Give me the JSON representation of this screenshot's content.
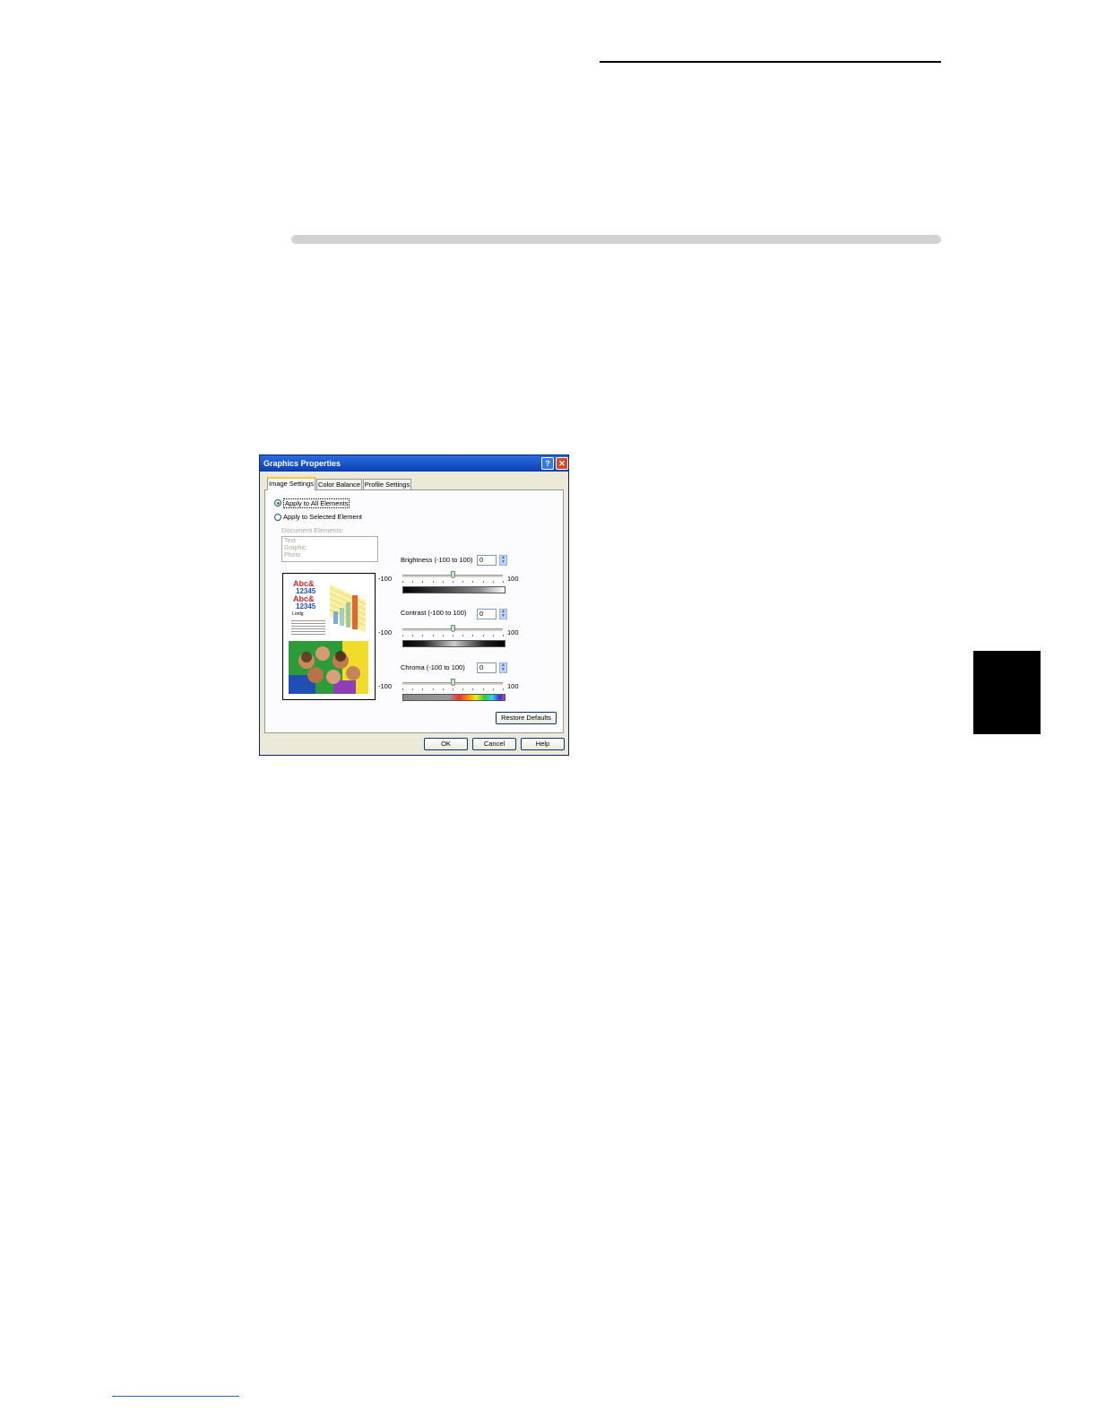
{
  "dialog": {
    "title": "Graphics Properties",
    "help_glyph": "?",
    "close_glyph": "✕",
    "tabs": [
      "Image Settings",
      "Color Balance",
      "Profile Settings"
    ],
    "apply_all_label": "Apply to All Elements",
    "apply_selected_label": "Apply to Selected Element",
    "document_elements_label": "Document Elements:",
    "document_elements": [
      "Text",
      "Graphic",
      "Photo"
    ],
    "preview": {
      "line1": "Abc&",
      "line2": "12345",
      "line3": "Abc&",
      "line4": "12345",
      "caption": "Lotdg"
    },
    "brightness": {
      "label": "Brightness (-100 to 100)",
      "value": "0",
      "min_label": "-100",
      "max_label": "100",
      "level": 0
    },
    "contrast": {
      "label": "Contrast (-100 to 100)",
      "value": "0",
      "min_label": "-100",
      "max_label": "100",
      "level": 0
    },
    "chroma": {
      "label": "Chroma (-100 to 100)",
      "value": "0",
      "min_label": "-100",
      "max_label": "100",
      "level": 0
    },
    "restore_defaults_label": "Restore Defaults",
    "ok_label": "OK",
    "cancel_label": "Cancel",
    "help_label": "Help",
    "colors": {
      "titlebar": "#0a3fb0",
      "dialog_bg": "#ece9d8",
      "tab_highlight": "#ffc83c"
    }
  }
}
